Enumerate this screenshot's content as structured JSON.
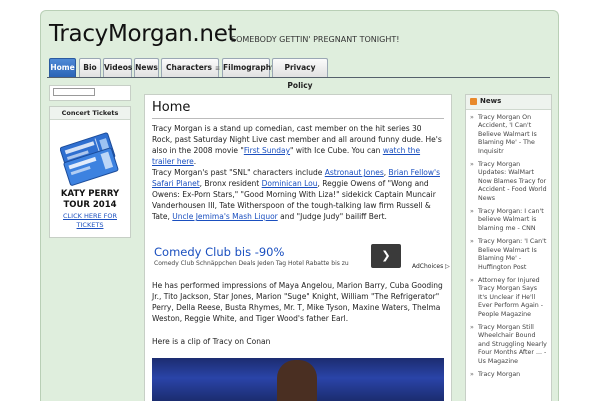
{
  "site": {
    "title": "TracyMorgan.net",
    "tagline": "SOMEBODY GETTIN' PREGNANT TONIGHT!"
  },
  "nav": {
    "tabs": [
      "Home",
      "Bio",
      "Videos",
      "News",
      "Characters",
      "Filmography",
      "Privacy Policy"
    ],
    "active": "Home"
  },
  "sidebar_left": {
    "search_placeholder": "",
    "widget_title": "Concert Tickets",
    "ticket_title": "KATY PERRY TOUR 2014",
    "ticket_link": "CLICK HERE FOR TICKETS"
  },
  "main": {
    "title": "Home",
    "p1": {
      "t1": "Tracy Morgan is a stand up comedian, cast member on the hit series 30 Rock, past Saturday Night Live cast member and all around funny dude. He's also in the 2008 movie \"",
      "l1": "First Sunday",
      "t2": "\" with Ice Cube. You can ",
      "l2": "watch the trailer here",
      "t3": "."
    },
    "p2": {
      "t1": "Tracy Morgan's past \"SNL\" characters include ",
      "l1": "Astronaut Jones",
      "t2": ", ",
      "l2": "Brian Fellow's Safari Planet",
      "t3": ", Bronx resident ",
      "l3": "Dominican Lou",
      "t4": ", Reggie Owens of \"Wong and Owens: Ex-Porn Stars,\" \"Good Morning With Liza!\" sidekick Captain Muncair Vanderhousen III, Tate Witherspoon of the tough-talking law firm Russell & Tate, ",
      "l4": "Uncle Jemima's Mash Liquor",
      "t5": " and \"Judge Judy\" bailiff Bert."
    },
    "ad": {
      "title": "Comedy Club bis -90%",
      "subtitle": "Comedy Club Schnäppchen Deals Jeden Tag Hotel Rabatte bis zu",
      "button": "❯",
      "choices": "AdChoices ▷"
    },
    "p3": "He has performed impressions of Maya Angelou, Marion Barry, Cuba Gooding Jr., Tito Jackson, Star Jones, Marion \"Suge\" Knight, William \"The Refrigerator\" Perry, Della Reese, Busta Rhymes, Mr. T, Mike Tyson, Maxine Waters, Thelma Weston, Reggie White, and Tiger Wood's father Earl.",
    "p4": "Here is a clip of Tracy on Conan"
  },
  "sidebar_right": {
    "title": "News",
    "items": [
      "Tracy Morgan On Accident, 'I Can't Believe Walmart Is Blaming Me' - The Inquisitr",
      "Tracy Morgan Updates: WalMart Now Blames Tracy for Accident - Food World News",
      "Tracy Morgan: I can't believe Walmart is blaming me - CNN",
      "Tracy Morgan: 'I Can't Believe Walmart Is Blaming Me' - Huffington Post",
      "Attorney for Injured Tracy Morgan Says It's Unclear if He'll Ever Perform Again - People Magazine",
      "Tracy Morgan Still Wheelchair Bound and Struggling Nearly Four Months After ... - Us Magazine",
      "Tracy Morgan"
    ]
  },
  "colors": {
    "accent": "#2a64b6",
    "link": "#1a4fbf",
    "page_bg": "#dfeedd"
  }
}
